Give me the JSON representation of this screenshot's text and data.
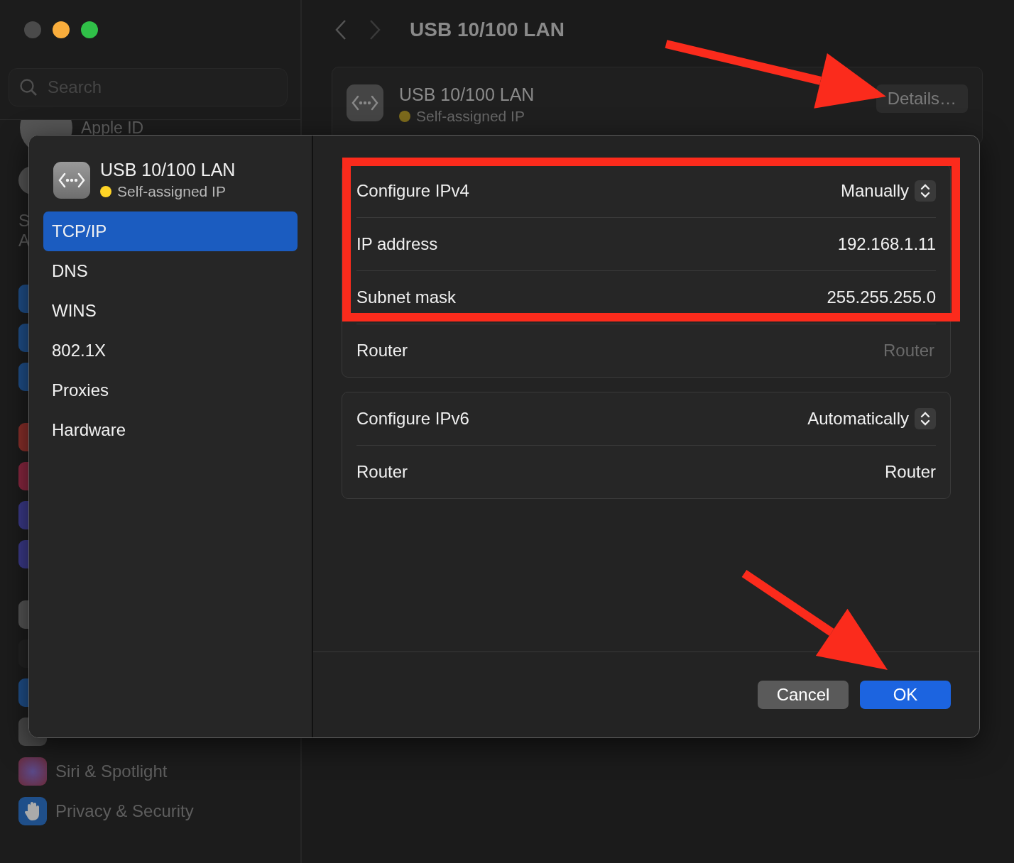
{
  "background_window": {
    "sidebar": {
      "search": {
        "placeholder": "Search"
      },
      "account": {
        "label": "Apple ID"
      },
      "section_letters": [
        "S",
        "A"
      ],
      "items": [
        {
          "label": "Siri & Spotlight"
        },
        {
          "label": "Privacy & Security"
        }
      ]
    },
    "toolbar": {
      "title": "USB 10/100 LAN"
    },
    "service": {
      "name": "USB 10/100 LAN",
      "status": "Self-assigned IP",
      "button": "Details…"
    }
  },
  "dialog": {
    "header": {
      "name": "USB 10/100 LAN",
      "status": "Self-assigned IP"
    },
    "tabs": [
      {
        "label": "TCP/IP",
        "selected": true
      },
      {
        "label": "DNS",
        "selected": false
      },
      {
        "label": "WINS",
        "selected": false
      },
      {
        "label": "802.1X",
        "selected": false
      },
      {
        "label": "Proxies",
        "selected": false
      },
      {
        "label": "Hardware",
        "selected": false
      }
    ],
    "groups": [
      {
        "rows": [
          {
            "kind": "popup",
            "label": "Configure IPv4",
            "value": "Manually"
          },
          {
            "kind": "value",
            "label": "IP address",
            "value": "192.168.1.11"
          },
          {
            "kind": "value",
            "label": "Subnet mask",
            "value": "255.255.255.0"
          },
          {
            "kind": "field",
            "label": "Router",
            "placeholder": "Router"
          }
        ]
      },
      {
        "rows": [
          {
            "kind": "popup",
            "label": "Configure IPv6",
            "value": "Automatically"
          },
          {
            "kind": "value",
            "label": "Router",
            "value": "Router"
          }
        ]
      }
    ],
    "buttons": [
      {
        "label": "Cancel",
        "kind": "secondary"
      },
      {
        "label": "OK",
        "kind": "primary"
      }
    ]
  },
  "annotations": [
    {
      "kind": "arrow"
    },
    {
      "kind": "frame"
    },
    {
      "kind": "arrow"
    }
  ]
}
